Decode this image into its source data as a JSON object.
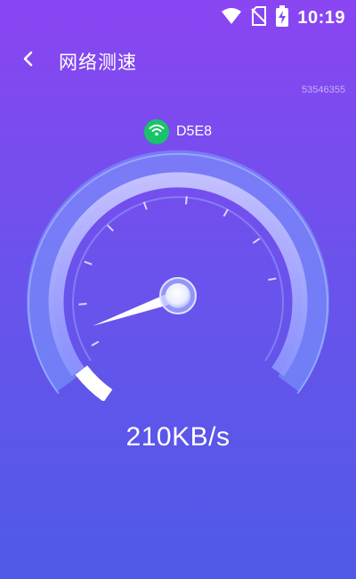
{
  "status_bar": {
    "time": "10:19",
    "icons": [
      "wifi-icon",
      "no-sim-icon",
      "battery-charging-icon"
    ]
  },
  "header": {
    "title": "网络测速",
    "back_icon": "chevron-left-icon"
  },
  "device_id": "53546355",
  "network": {
    "ssid": "D5E8",
    "icon": "wifi-icon",
    "badge_color": "#17c46a"
  },
  "gauge": {
    "level": 0.07
  },
  "speed": {
    "text": "210KB/s"
  },
  "colors": {
    "gradient_top": "#8a45f2",
    "gradient_bottom": "#4f5ae7",
    "wifi_badge": "#17c46a"
  }
}
